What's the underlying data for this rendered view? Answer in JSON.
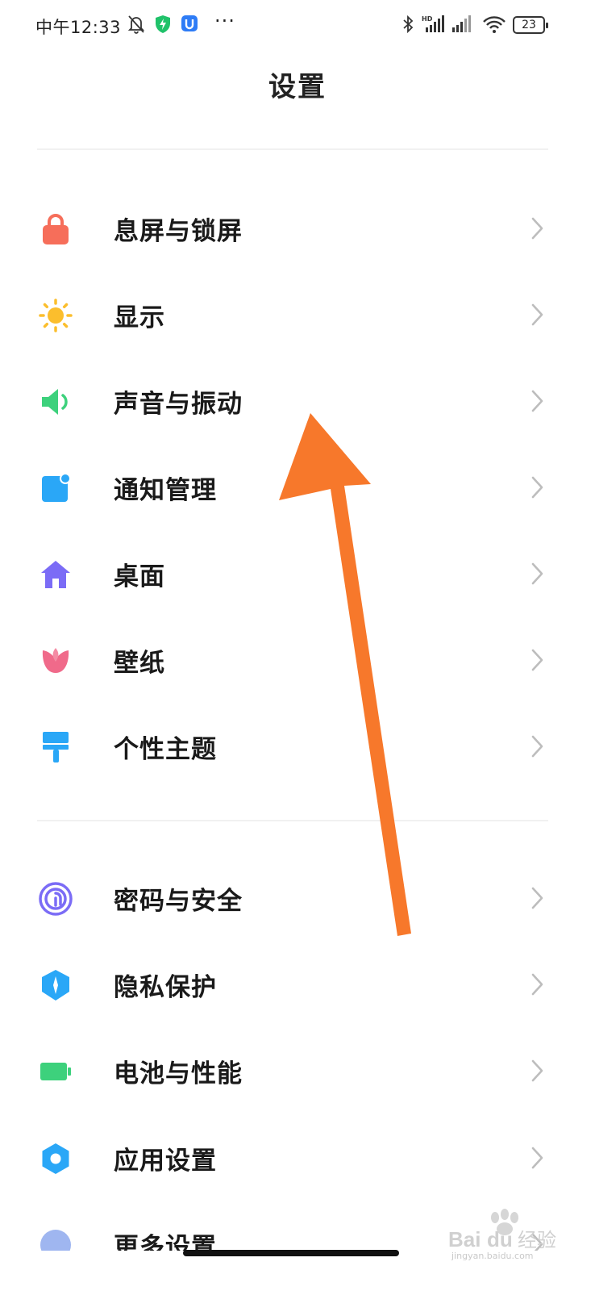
{
  "status_bar": {
    "time": "中午12:33",
    "battery": "23",
    "more": "···"
  },
  "header": {
    "title": "设置"
  },
  "groups": [
    {
      "items": [
        {
          "label": "息屏与锁屏",
          "icon": "lock-icon",
          "color": "#F66E5A"
        },
        {
          "label": "显示",
          "icon": "sun-icon",
          "color": "#FBBE2D"
        },
        {
          "label": "声音与振动",
          "icon": "speaker-icon",
          "color": "#3DD17C"
        },
        {
          "label": "通知管理",
          "icon": "notification-icon",
          "color": "#2AA7F7"
        },
        {
          "label": "桌面",
          "icon": "home-icon",
          "color": "#7B6CF6"
        },
        {
          "label": "壁纸",
          "icon": "tulip-icon",
          "color": "#F06A8A"
        },
        {
          "label": "个性主题",
          "icon": "brush-icon",
          "color": "#2AA7F7"
        }
      ]
    },
    {
      "items": [
        {
          "label": "密码与安全",
          "icon": "fingerprint-icon",
          "color": "#7B6CF6"
        },
        {
          "label": "隐私保护",
          "icon": "privacy-shield-icon",
          "color": "#2AA7F7"
        },
        {
          "label": "电池与性能",
          "icon": "battery-icon",
          "color": "#3DD17C"
        },
        {
          "label": "应用设置",
          "icon": "gear-icon",
          "color": "#2AA7F7"
        },
        {
          "label": "更多设置",
          "icon": "more-settings-icon",
          "color": "#9FB6F0"
        }
      ]
    }
  ],
  "annotation": {
    "arrow_color": "#F7782B"
  },
  "watermark": {
    "brand": "Baidu经验",
    "url": "jingyan.baidu.com"
  }
}
